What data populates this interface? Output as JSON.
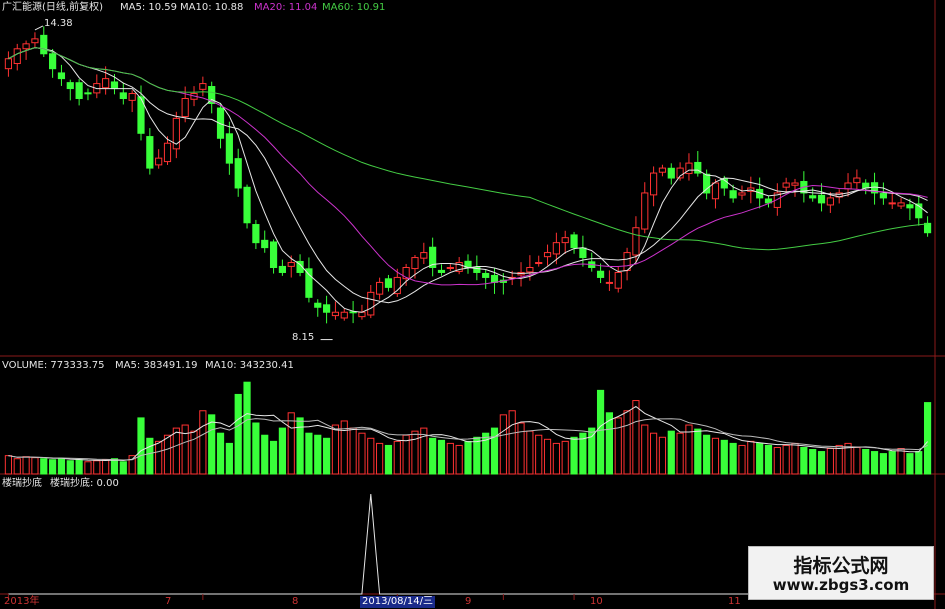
{
  "header": {
    "stock": "广汇能源(日线,前复权)",
    "ma_items": [
      {
        "label": "MA5: 10.59",
        "color": "#e6e6e6"
      },
      {
        "label": "MA10: 10.88",
        "color": "#e6e6e6"
      },
      {
        "label": "MA20: 11.04",
        "color": "#cc33cc"
      },
      {
        "label": "MA60: 10.91",
        "color": "#44cc44"
      }
    ],
    "high_label": "14.38",
    "low_label": "8.15"
  },
  "volume_header": {
    "label": "VOLUME: 773333.75",
    "ma5": "MA5: 383491.19",
    "ma10": "MA10: 343230.41"
  },
  "indicator_header": {
    "name": "楼瑞抄底",
    "value": "楼瑞抄底: 0.00"
  },
  "xaxis": {
    "labels": [
      "2013年",
      "7",
      "8",
      "2013/08/14/三",
      "9",
      "10",
      "11"
    ]
  },
  "watermark": {
    "line1": "指标公式网",
    "line2": "www.zbgs3.com"
  },
  "colors": {
    "up": "#ff3232",
    "down": "#39ff3a",
    "ma5": "#e6e6e6",
    "ma10": "#e6e6e6",
    "ma20": "#cc33cc",
    "ma60": "#44cc44",
    "grid": "#8a1a1a"
  },
  "chart_data": [
    {
      "type": "candlestick",
      "title": "广汇能源(日线,前复权)",
      "ylim": [
        7.9,
        14.7
      ],
      "high": 14.38,
      "low": 8.15,
      "close_series": [
        13.8,
        14.0,
        14.1,
        14.2,
        13.9,
        13.6,
        13.4,
        13.2,
        13.0,
        13.1,
        13.3,
        13.4,
        13.2,
        13.0,
        13.1,
        12.3,
        11.6,
        11.8,
        12.1,
        12.6,
        13.0,
        13.1,
        13.3,
        12.9,
        12.2,
        11.7,
        11.2,
        10.5,
        10.1,
        10.0,
        9.6,
        9.5,
        9.7,
        9.5,
        9.0,
        8.8,
        8.7,
        8.7,
        8.7,
        8.7,
        8.7,
        9.1,
        9.3,
        9.2,
        9.4,
        9.6,
        9.8,
        9.9,
        9.6,
        9.5,
        9.6,
        9.7,
        9.6,
        9.5,
        9.4,
        9.3,
        9.3,
        9.4,
        9.5,
        9.6,
        9.7,
        9.9,
        10.1,
        10.2,
        10.0,
        9.8,
        9.6,
        9.4,
        9.3,
        9.5,
        9.9,
        10.4,
        11.1,
        11.5,
        11.6,
        11.4,
        11.6,
        11.7,
        11.5,
        11.1,
        11.3,
        11.2,
        11.0,
        11.1,
        11.2,
        11.0,
        10.9,
        11.1,
        11.3,
        11.3,
        11.1,
        11.0,
        10.9,
        11.0,
        11.1,
        11.3,
        11.4,
        11.2,
        11.1,
        11.0,
        10.9,
        10.9,
        10.8,
        10.6,
        10.3
      ],
      "ma_lines": [
        {
          "name": "MA5",
          "value": 10.59
        },
        {
          "name": "MA10",
          "value": 10.88
        },
        {
          "name": "MA20",
          "value": 11.04
        },
        {
          "name": "MA60",
          "value": 10.91
        }
      ]
    },
    {
      "type": "bar",
      "title": "VOLUME",
      "last_volume": 773333.75,
      "ma5": 383491.19,
      "ma10": 343230.41,
      "values": [
        0.18,
        0.15,
        0.17,
        0.16,
        0.15,
        0.14,
        0.15,
        0.13,
        0.14,
        0.12,
        0.13,
        0.14,
        0.15,
        0.12,
        0.18,
        0.55,
        0.35,
        0.32,
        0.38,
        0.45,
        0.48,
        0.42,
        0.62,
        0.58,
        0.4,
        0.3,
        0.78,
        0.9,
        0.5,
        0.38,
        0.32,
        0.45,
        0.6,
        0.55,
        0.4,
        0.38,
        0.35,
        0.48,
        0.52,
        0.45,
        0.4,
        0.35,
        0.3,
        0.28,
        0.32,
        0.38,
        0.42,
        0.45,
        0.35,
        0.33,
        0.3,
        0.28,
        0.32,
        0.36,
        0.4,
        0.45,
        0.58,
        0.62,
        0.5,
        0.42,
        0.38,
        0.34,
        0.3,
        0.32,
        0.36,
        0.4,
        0.45,
        0.82,
        0.6,
        0.55,
        0.62,
        0.72,
        0.48,
        0.4,
        0.36,
        0.42,
        0.4,
        0.48,
        0.44,
        0.38,
        0.35,
        0.33,
        0.3,
        0.28,
        0.32,
        0.3,
        0.28,
        0.26,
        0.28,
        0.3,
        0.26,
        0.24,
        0.22,
        0.25,
        0.28,
        0.3,
        0.26,
        0.24,
        0.22,
        0.2,
        0.22,
        0.25,
        0.2,
        0.22,
        0.7
      ]
    },
    {
      "type": "line",
      "title": "楼瑞抄底",
      "last_value": 0.0,
      "values_note_index": 41,
      "values": [
        0,
        0,
        0,
        0,
        0,
        0,
        0,
        0,
        0,
        0,
        0,
        0,
        0,
        0,
        0,
        0,
        0,
        0,
        0,
        0,
        0,
        0,
        0,
        0,
        0,
        0,
        0,
        0,
        0,
        0,
        0,
        0,
        0,
        0,
        0,
        0,
        0,
        0,
        0,
        0,
        0,
        1,
        0,
        0,
        0,
        0,
        0,
        0,
        0,
        0,
        0,
        0,
        0,
        0,
        0,
        0,
        0,
        0,
        0,
        0,
        0,
        0,
        0,
        0,
        0,
        0,
        0,
        0,
        0,
        0,
        0,
        0,
        0,
        0,
        0,
        0,
        0,
        0,
        0,
        0,
        0,
        0,
        0,
        0,
        0,
        0,
        0,
        0,
        0,
        0,
        0,
        0,
        0,
        0,
        0,
        0,
        0,
        0,
        0,
        0,
        0,
        0,
        0,
        0,
        0
      ]
    }
  ]
}
